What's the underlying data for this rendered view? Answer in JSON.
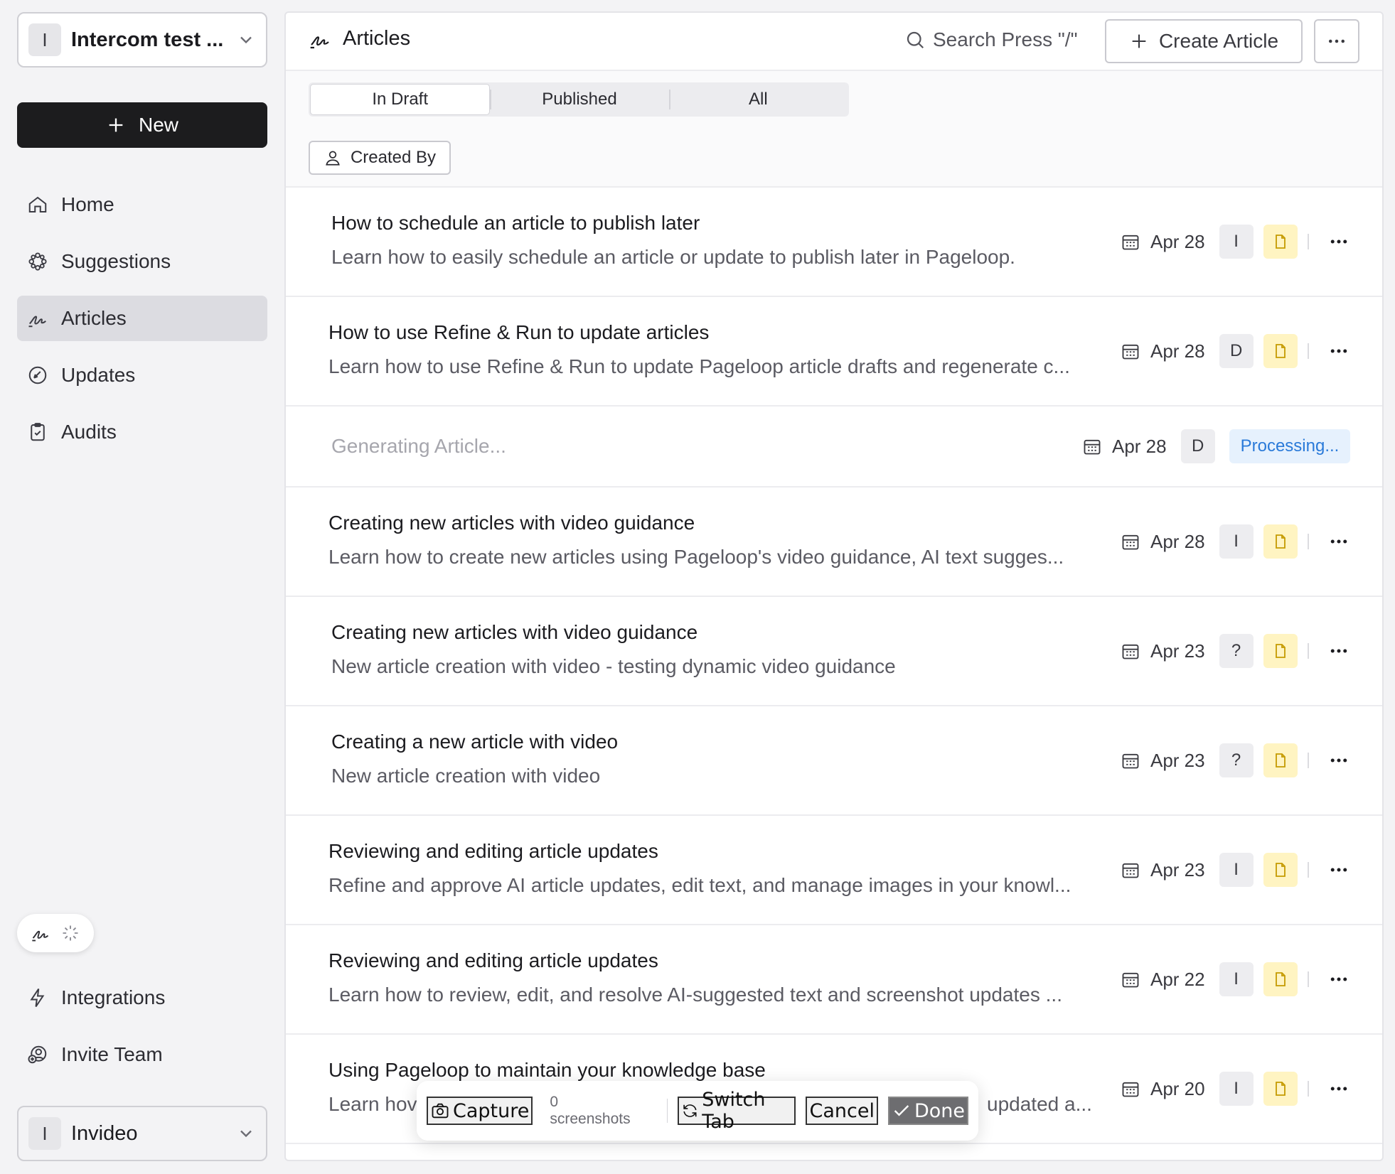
{
  "sidebar": {
    "workspace_top": {
      "initial": "I",
      "name": "Intercom test ..."
    },
    "new_label": "New",
    "nav": [
      {
        "label": "Home",
        "icon": "home-icon"
      },
      {
        "label": "Suggestions",
        "icon": "suggestions-icon"
      },
      {
        "label": "Articles",
        "icon": "articles-icon",
        "active": true
      },
      {
        "label": "Updates",
        "icon": "updates-icon"
      },
      {
        "label": "Audits",
        "icon": "audits-icon"
      }
    ],
    "bottom_nav": [
      {
        "label": "Integrations",
        "icon": "lightning-icon"
      },
      {
        "label": "Invite Team",
        "icon": "invite-team-icon"
      }
    ],
    "workspace_bottom": {
      "initial": "I",
      "name": "Invideo"
    }
  },
  "header": {
    "title": "Articles",
    "search_label": "Search Press \"/\"",
    "create_label": "Create Article"
  },
  "tabs": [
    {
      "label": "In Draft",
      "active": true
    },
    {
      "label": "Published",
      "active": false
    },
    {
      "label": "All",
      "active": false
    }
  ],
  "filter": {
    "created_by_label": "Created By"
  },
  "articles": [
    {
      "title": "How to schedule an article to publish later",
      "desc": "Learn how to easily schedule an article or update to publish later in Pageloop.",
      "date": "Apr 28",
      "author": "I"
    },
    {
      "title": "How to use Refine & Run to update articles",
      "desc": "Learn how to use Refine & Run to update Pageloop article drafts and regenerate c...",
      "date": "Apr 28",
      "author": "D"
    },
    {
      "title": "Generating Article...",
      "desc": "",
      "date": "Apr 28",
      "author": "D",
      "status": "Processing..."
    },
    {
      "title": "Creating new articles with video guidance",
      "desc": "Learn how to create new articles using Pageloop's video guidance, AI text sugges...",
      "date": "Apr 28",
      "author": "I"
    },
    {
      "title": "Creating new articles with video guidance",
      "desc": "New article creation with video - testing dynamic video guidance",
      "date": "Apr 23",
      "author": "?"
    },
    {
      "title": "Creating a new article with video",
      "desc": "New article creation with video",
      "date": "Apr 23",
      "author": "?"
    },
    {
      "title": "Reviewing and editing article updates",
      "desc": "Refine and approve AI article updates, edit text, and manage images in your knowl...",
      "date": "Apr 23",
      "author": "I"
    },
    {
      "title": "Reviewing and editing article updates",
      "desc": "Learn how to review, edit, and resolve AI-suggested text and screenshot updates ...",
      "date": "Apr 22",
      "author": "I"
    },
    {
      "title": "Using Pageloop to maintain your knowledge base",
      "desc_start": "Learn hov",
      "desc_end": "updated a...",
      "date": "Apr 20",
      "author": "I"
    }
  ],
  "capture_toolbar": {
    "capture_label": "Capture",
    "count_label": "0 screenshots",
    "switch_label": "Switch Tab",
    "cancel_label": "Cancel",
    "done_label": "Done"
  },
  "colors": {
    "primary_button": "#1c1c1e",
    "processing_text": "#2a7ad9",
    "processing_bg": "#e6f1fd",
    "draft_doc_bg": "#fff4c2",
    "draft_doc_icon": "#c59a00"
  }
}
